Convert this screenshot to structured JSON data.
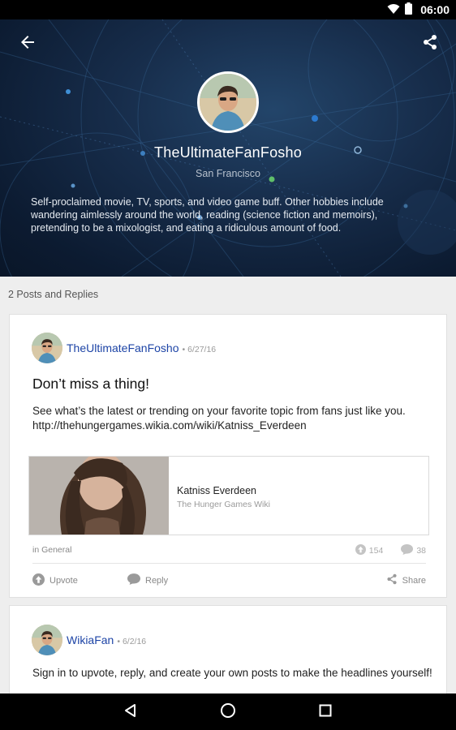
{
  "status_bar": {
    "time": "06:00"
  },
  "profile": {
    "username": "TheUltimateFanFosho",
    "location": "San Francisco",
    "bio": "Self-proclaimed movie, TV, sports, and video game buff. Other hobbies include wandering aimlessly around the world, reading (science fiction and memoirs), pretending to be a mixologist, and eating a ridiculous amount of food."
  },
  "section_label": "2 Posts and Replies",
  "posts": [
    {
      "author": "TheUltimateFanFosho",
      "date": "• 6/27/16",
      "title": "Don’t miss a thing!",
      "body": "See what’s the latest or trending on your favorite topic from fans just like you.",
      "url": "http://thehungergames.wikia.com/wiki/Katniss_Everdeen",
      "preview": {
        "title": "Katniss Everdeen",
        "site": "The Hunger Games Wiki"
      },
      "category": "in General",
      "upvotes": "154",
      "replies": "38",
      "actions": {
        "upvote": "Upvote",
        "reply": "Reply",
        "share": "Share"
      }
    },
    {
      "author": "WikiaFan",
      "date": "• 6/2/16",
      "body": "Sign in to upvote, reply, and create your own posts to make the headlines yourself!"
    }
  ],
  "icons": {
    "back": "arrow-back-icon",
    "share": "share-icon",
    "wifi": "wifi-icon",
    "battery": "battery-icon",
    "upvote": "upvote-icon",
    "reply": "comment-icon",
    "nav_back": "triangle-back-icon",
    "nav_home": "circle-home-icon",
    "nav_recents": "square-recents-icon"
  },
  "colors": {
    "author_link": "#1d44a6",
    "header_bg": "#102340"
  }
}
